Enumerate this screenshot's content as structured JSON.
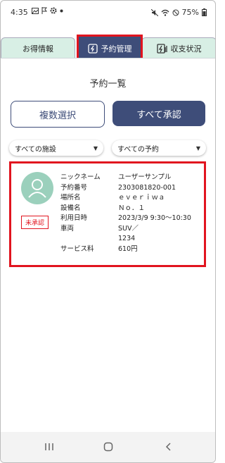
{
  "status_bar": {
    "time": "4:35",
    "battery": "75%"
  },
  "tabs": [
    {
      "label": "お得情報"
    },
    {
      "label": "予約管理"
    },
    {
      "label": "収支状況"
    }
  ],
  "page": {
    "title": "予約一覧"
  },
  "actions": {
    "multi_select": "複数選択",
    "approve_all": "すべて承認"
  },
  "filters": {
    "facility": {
      "value": "すべての施設"
    },
    "reservation": {
      "value": "すべての予約"
    }
  },
  "reservation": {
    "status": "未承認",
    "fields": [
      {
        "label": "ニックネーム",
        "value": "ユーザーサンプル"
      },
      {
        "label": "予約番号",
        "value": "2303081820-001"
      },
      {
        "label": "場所名",
        "value": "ｅｖｅｒｉｗａ"
      },
      {
        "label": "設備名",
        "value": "Ｎｏ．１"
      },
      {
        "label": "利用日時",
        "value": "2023/3/9 9:30〜10:30"
      },
      {
        "label": "車両",
        "value": "SUV／"
      },
      {
        "label": "",
        "value": "1234"
      },
      {
        "label": "サービス料",
        "value": "610円"
      }
    ]
  },
  "colors": {
    "primary": "#3e4d79",
    "highlight": "#e1141f",
    "tab_bg": "#d8efe5",
    "avatar": "#9bd0bc"
  },
  "icons": [
    "gallery-icon",
    "flag-icon",
    "gear-icon",
    "dot-icon",
    "mute-icon",
    "wifi-icon",
    "dnd-icon",
    "battery-icon",
    "coupon-icon",
    "ev-charge-icon",
    "revenue-icon",
    "user-icon",
    "recents-icon",
    "home-icon",
    "back-icon"
  ]
}
